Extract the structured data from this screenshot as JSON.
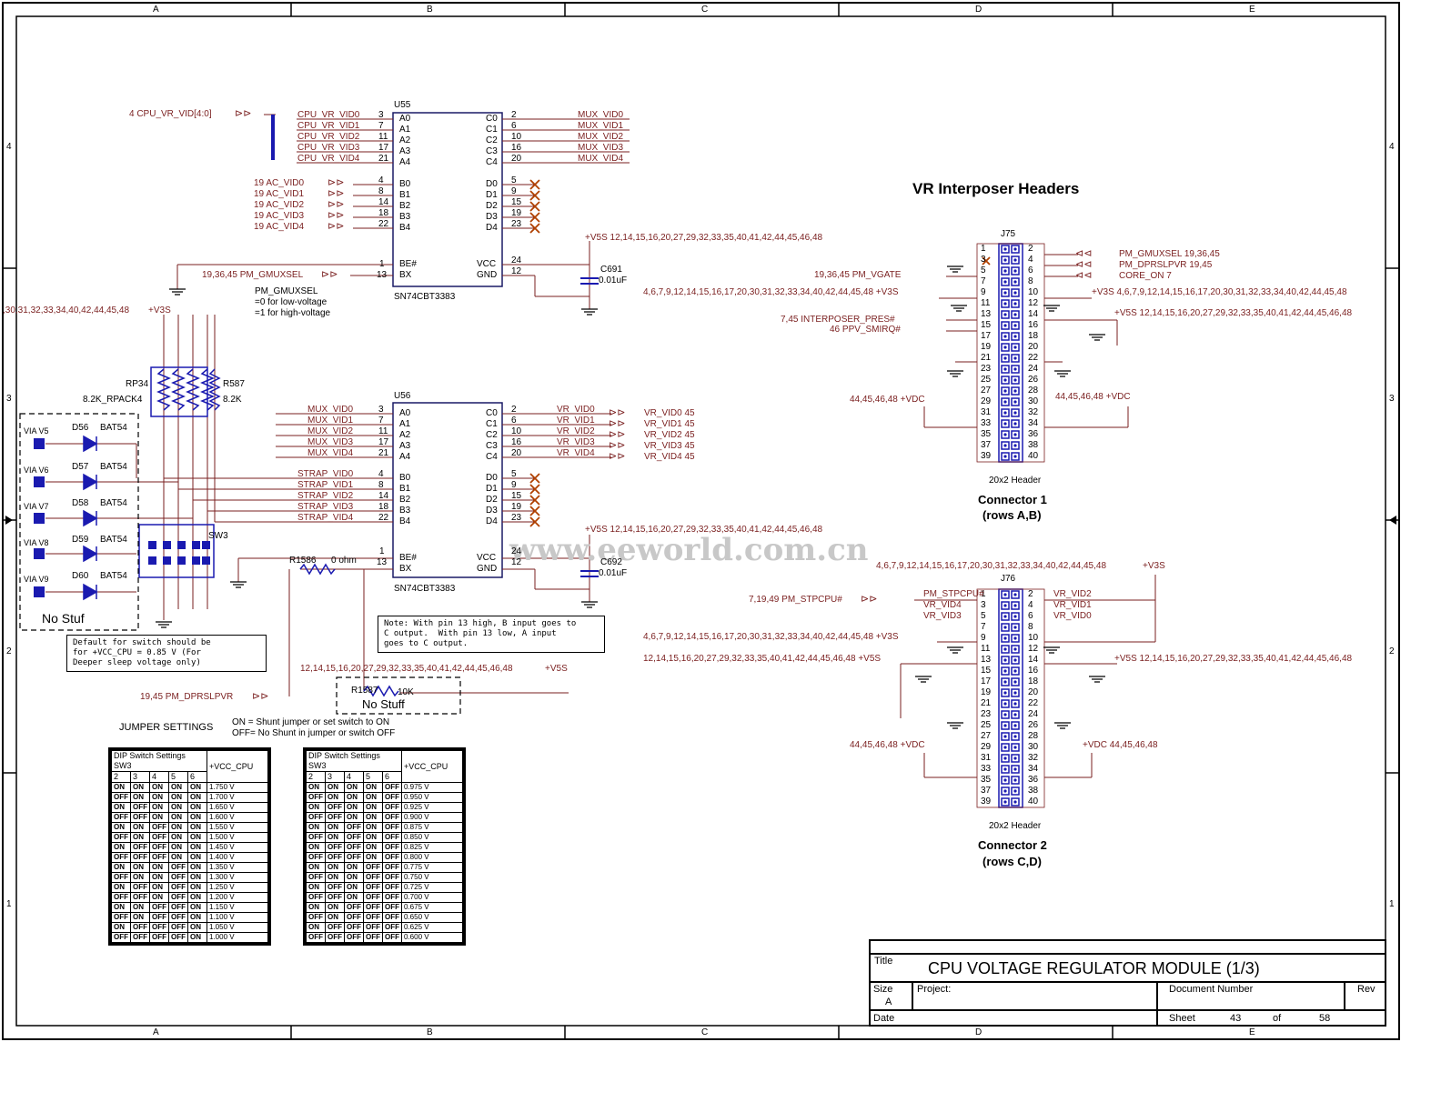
{
  "watermark": "www.eeworld.com.cn",
  "zones": {
    "cols": [
      "A",
      "B",
      "C",
      "D",
      "E"
    ],
    "rows": [
      "4",
      "3",
      "2",
      "1"
    ]
  },
  "heading": "VR Interposer Headers",
  "title_block": {
    "title_label": "Title",
    "title": "CPU VOLTAGE REGULATOR MODULE (1/3)",
    "size_label": "Size",
    "size": "A",
    "project_label": "Project:",
    "docnum_label": "Document Number",
    "rev_label": "Rev",
    "date_label": "Date",
    "sheet_label": "Sheet",
    "sheet": "43",
    "of_label": "of",
    "total": "58"
  },
  "u55": {
    "ref": "U55",
    "part": "SN74CBT3383",
    "bus_label": "4  CPU_VR_VID[4:0]",
    "a_nets": [
      "CPU_VR_VID0",
      "CPU_VR_VID1",
      "CPU_VR_VID2",
      "CPU_VR_VID3",
      "CPU_VR_VID4"
    ],
    "a_pins": [
      "3",
      "7",
      "11",
      "17",
      "21"
    ],
    "a_names": [
      "A0",
      "A1",
      "A2",
      "A3",
      "A4"
    ],
    "c_pins": [
      "2",
      "6",
      "10",
      "16",
      "20"
    ],
    "c_names": [
      "C0",
      "C1",
      "C2",
      "C3",
      "C4"
    ],
    "c_nets": [
      "MUX_VID0",
      "MUX_VID1",
      "MUX_VID2",
      "MUX_VID3",
      "MUX_VID4"
    ],
    "b_nets": [
      "19  AC_VID0",
      "19  AC_VID1",
      "19  AC_VID2",
      "19  AC_VID3",
      "19  AC_VID4"
    ],
    "b_pins": [
      "4",
      "8",
      "14",
      "18",
      "22"
    ],
    "b_names": [
      "B0",
      "B1",
      "B2",
      "B3",
      "B4"
    ],
    "d_pins": [
      "5",
      "9",
      "15",
      "19",
      "23"
    ],
    "d_names": [
      "D0",
      "D1",
      "D2",
      "D3",
      "D4"
    ],
    "be_pin": "1",
    "be_name": "BE#",
    "bx_pin": "13",
    "bx_name": "BX",
    "vcc_pin": "24",
    "vcc_name": "VCC",
    "gnd_pin": "12",
    "gnd_name": "GND",
    "bx_net": "19,36,45  PM_GMUXSEL",
    "power_net": "+V5S  12,14,15,16,20,27,29,32,33,35,40,41,42,44,45,46,48",
    "cap_ref": "C691",
    "cap_val": "0.01uF",
    "mux_note": [
      "PM_GMUXSEL",
      "=0 for low-voltage",
      "=1 for high-voltage"
    ]
  },
  "u56": {
    "ref": "U56",
    "part": "SN74CBT3383",
    "a_nets": [
      "MUX_VID0",
      "MUX_VID1",
      "MUX_VID2",
      "MUX_VID3",
      "MUX_VID4"
    ],
    "a_pins": [
      "3",
      "7",
      "11",
      "17",
      "21"
    ],
    "a_names": [
      "A0",
      "A1",
      "A2",
      "A3",
      "A4"
    ],
    "c_pins": [
      "2",
      "6",
      "10",
      "16",
      "20"
    ],
    "c_names": [
      "C0",
      "C1",
      "C2",
      "C3",
      "C4"
    ],
    "c_nets": [
      "VR_VID0",
      "VR_VID1",
      "VR_VID2",
      "VR_VID3",
      "VR_VID4"
    ],
    "out_nets": [
      "VR_VID0  45",
      "VR_VID1  45",
      "VR_VID2  45",
      "VR_VID3  45",
      "VR_VID4  45"
    ],
    "b_nets": [
      "STRAP_VID0",
      "STRAP_VID1",
      "STRAP_VID2",
      "STRAP_VID3",
      "STRAP_VID4"
    ],
    "b_pins": [
      "4",
      "8",
      "14",
      "18",
      "22"
    ],
    "b_names": [
      "B0",
      "B1",
      "B2",
      "B3",
      "B4"
    ],
    "d_pins": [
      "5",
      "9",
      "15",
      "19",
      "23"
    ],
    "d_names": [
      "D0",
      "D1",
      "D2",
      "D3",
      "D4"
    ],
    "be_pin": "1",
    "be_name": "BE#",
    "bx_pin": "13",
    "bx_name": "BX",
    "vcc_pin": "24",
    "vcc_name": "VCC",
    "gnd_pin": "12",
    "gnd_name": "GND",
    "power_net": "+V5S  12,14,15,16,20,27,29,32,33,35,40,41,42,44,45,46,48",
    "cap_ref": "C692",
    "cap_val": "0.01uF",
    "note": "Note: With pin 13 high, B input goes to\nC output.  With pin 13 low, A input\ngoes to C output."
  },
  "strap": {
    "v3s_net": ",30,31,32,33,34,40,42,44,45,48",
    "v3s_label": "+V3S",
    "rp_ref": "RP34",
    "rp_val": "8.2K_RPACK4",
    "r587_ref": "R587",
    "r587_val": "8.2K",
    "sw_ref": "SW3",
    "vias": [
      "VIA V5",
      "VIA V6",
      "VIA V7",
      "VIA V8",
      "VIA V9"
    ],
    "diodes": [
      "D56",
      "D57",
      "D58",
      "D59",
      "D60"
    ],
    "diode_part": "BAT54",
    "nostuf": "No Stuf",
    "default_note": "Default for switch should be\nfor +VCC_CPU = 0.85 V (For\nDeeper sleep voltage only)",
    "r1586_ref": "R1586",
    "r1586_val": "0 ohm",
    "r1587_ref": "R1587",
    "r1587_val": "10K",
    "r1587_note": "No Stuff",
    "dprslp_net": "19,45  PM_DPRSLPVR",
    "v5s_net": "12,14,15,16,20,27,29,32,33,35,40,41,42,44,45,46,48",
    "v5s_label": "+V5S"
  },
  "jumper": {
    "title": "JUMPER SETTINGS",
    "on_text": "ON = Shunt jumper or set switch to ON",
    "off_text": "OFF= No Shunt in jumper or switch OFF",
    "dip_label": "DIP Switch Settings",
    "sw_label": "SW3",
    "cols": [
      "2",
      "3",
      "4",
      "5",
      "6"
    ],
    "vcc_label": "+VCC_CPU",
    "left_rows": [
      [
        "ON",
        "ON",
        "ON",
        "ON",
        "ON",
        "1.750 V"
      ],
      [
        "OFF",
        "ON",
        "ON",
        "ON",
        "ON",
        "1.700 V"
      ],
      [
        "ON",
        "OFF",
        "ON",
        "ON",
        "ON",
        "1.650 V"
      ],
      [
        "OFF",
        "OFF",
        "ON",
        "ON",
        "ON",
        "1.600 V"
      ],
      [
        "ON",
        "ON",
        "OFF",
        "ON",
        "ON",
        "1.550 V"
      ],
      [
        "OFF",
        "ON",
        "OFF",
        "ON",
        "ON",
        "1.500 V"
      ],
      [
        "ON",
        "OFF",
        "OFF",
        "ON",
        "ON",
        "1.450 V"
      ],
      [
        "OFF",
        "OFF",
        "OFF",
        "ON",
        "ON",
        "1.400 V"
      ],
      [
        "ON",
        "ON",
        "ON",
        "OFF",
        "ON",
        "1.350 V"
      ],
      [
        "OFF",
        "ON",
        "ON",
        "OFF",
        "ON",
        "1.300 V"
      ],
      [
        "ON",
        "OFF",
        "ON",
        "OFF",
        "ON",
        "1.250 V"
      ],
      [
        "OFF",
        "OFF",
        "ON",
        "OFF",
        "ON",
        "1.200 V"
      ],
      [
        "ON",
        "ON",
        "OFF",
        "OFF",
        "ON",
        "1.150 V"
      ],
      [
        "OFF",
        "ON",
        "OFF",
        "OFF",
        "ON",
        "1.100 V"
      ],
      [
        "ON",
        "OFF",
        "OFF",
        "OFF",
        "ON",
        "1.050 V"
      ],
      [
        "OFF",
        "OFF",
        "OFF",
        "OFF",
        "ON",
        "1.000 V"
      ]
    ],
    "right_rows": [
      [
        "ON",
        "ON",
        "ON",
        "ON",
        "OFF",
        "0.975 V"
      ],
      [
        "OFF",
        "ON",
        "ON",
        "ON",
        "OFF",
        "0.950 V"
      ],
      [
        "ON",
        "OFF",
        "ON",
        "ON",
        "OFF",
        "0.925 V"
      ],
      [
        "OFF",
        "OFF",
        "ON",
        "ON",
        "OFF",
        "0.900 V"
      ],
      [
        "ON",
        "ON",
        "OFF",
        "ON",
        "OFF",
        "0.875 V"
      ],
      [
        "OFF",
        "ON",
        "OFF",
        "ON",
        "OFF",
        "0.850 V"
      ],
      [
        "ON",
        "OFF",
        "OFF",
        "ON",
        "OFF",
        "0.825 V"
      ],
      [
        "OFF",
        "OFF",
        "OFF",
        "ON",
        "OFF",
        "0.800 V"
      ],
      [
        "ON",
        "ON",
        "ON",
        "OFF",
        "OFF",
        "0.775 V"
      ],
      [
        "OFF",
        "ON",
        "ON",
        "OFF",
        "OFF",
        "0.750 V"
      ],
      [
        "ON",
        "OFF",
        "ON",
        "OFF",
        "OFF",
        "0.725 V"
      ],
      [
        "OFF",
        "OFF",
        "ON",
        "OFF",
        "OFF",
        "0.700 V"
      ],
      [
        "ON",
        "ON",
        "OFF",
        "OFF",
        "OFF",
        "0.675 V"
      ],
      [
        "OFF",
        "ON",
        "OFF",
        "OFF",
        "OFF",
        "0.650 V"
      ],
      [
        "ON",
        "OFF",
        "OFF",
        "OFF",
        "OFF",
        "0.625 V"
      ],
      [
        "OFF",
        "OFF",
        "OFF",
        "OFF",
        "OFF",
        "0.600 V"
      ]
    ]
  },
  "j75": {
    "ref": "J75",
    "part": "20x2 Header",
    "caption1": "Connector 1",
    "caption2": "(rows A,B)",
    "right_nets": [
      "PM_GMUXSEL  19,36,45",
      "PM_DPRSLPVR  19,45",
      "CORE_ON  7"
    ],
    "vgate_net": "19,36,45  PM_VGATE",
    "v3s_left": "4,6,7,9,12,14,15,16,17,20,30,31,32,33,34,40,42,44,45,48   +V3S",
    "v3s_right": "+V3S  4,6,7,9,12,14,15,16,17,20,30,31,32,33,34,40,42,44,45,48",
    "v5s_right": "+V5S  12,14,15,16,20,27,29,32,33,35,40,41,42,44,45,46,48",
    "pres_net": "7,45  INTERPOSER_PRES#",
    "smi_net": "46  PPV_SMIRQ#",
    "vdc_left": "44,45,46,48   +VDC",
    "vdc_right": "44,45,46,48  +VDC"
  },
  "j76": {
    "ref": "J76",
    "part": "20x2 Header",
    "caption1": "Connector 2",
    "caption2": "(rows C,D)",
    "top_net": "4,6,7,9,12,14,15,16,17,20,30,31,32,33,34,40,42,44,45,48",
    "top_v3s": "+V3S",
    "stp_net": "7,19,49  PM_STPCPU#",
    "left_nets": [
      "PM_STPCPU#",
      "VR_VID4",
      "VR_VID3"
    ],
    "right_nets": [
      "VR_VID2",
      "VR_VID1",
      "VR_VID0"
    ],
    "v3s_left": "4,6,7,9,12,14,15,16,17,20,30,31,32,33,34,40,42,44,45,48   +V3S",
    "v5s_left": "12,14,15,16,20,27,29,32,33,35,40,41,42,44,45,46,48   +V5S",
    "v5s_right": "+V5S  12,14,15,16,20,27,29,32,33,35,40,41,42,44,45,46,48",
    "vdc_left": "44,45,46,48   +VDC",
    "vdc_right": "+VDC  44,45,46,48"
  },
  "pin_left": [
    "1",
    "3",
    "5",
    "7",
    "9",
    "11",
    "13",
    "15",
    "17",
    "19",
    "21",
    "23",
    "25",
    "27",
    "29",
    "31",
    "33",
    "35",
    "37",
    "39"
  ],
  "pin_right": [
    "2",
    "4",
    "6",
    "8",
    "10",
    "12",
    "14",
    "16",
    "18",
    "20",
    "22",
    "24",
    "26",
    "28",
    "30",
    "32",
    "34",
    "36",
    "38",
    "40"
  ]
}
